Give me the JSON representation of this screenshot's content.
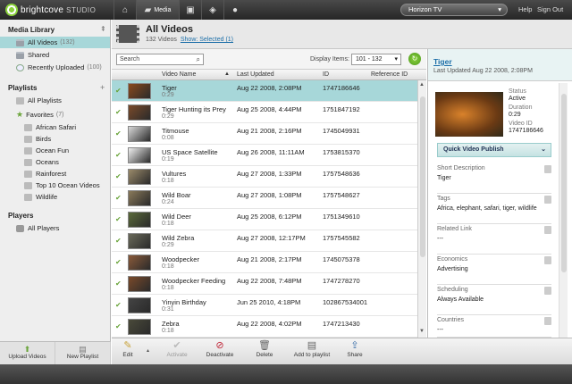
{
  "top": {
    "brand": "brightcove",
    "studio": "STUDIO",
    "nav_media_label": "Media",
    "account": "Horizon TV",
    "help": "Help",
    "signout": "Sign Out"
  },
  "sidebar": {
    "library_title": "Media Library",
    "library_items": [
      {
        "label": "All Videos",
        "count": "(132)"
      },
      {
        "label": "Shared",
        "count": ""
      },
      {
        "label": "Recently Uploaded",
        "count": "(100)"
      }
    ],
    "playlists_title": "Playlists",
    "all_playlists": "All Playlists",
    "favorites": {
      "label": "Favorites",
      "count": "(7)"
    },
    "playlist_items": [
      "African Safari",
      "Birds",
      "Ocean Fun",
      "Oceans",
      "Rainforest",
      "Top 10 Ocean Videos",
      "Wildlife"
    ],
    "players_title": "Players",
    "all_players": "All Players",
    "upload_label": "Upload Videos",
    "new_playlist_label": "New Playlist"
  },
  "header": {
    "title": "All Videos",
    "count": "132 Videos",
    "show_selected": "Show: Selected (1)"
  },
  "toolbar": {
    "search_placeholder": "Search",
    "display_label": "Display Items:",
    "display_value": "101 - 132"
  },
  "table": {
    "columns": [
      "Video Name",
      "Last Updated",
      "ID",
      "Reference ID"
    ],
    "rows": [
      {
        "name": "Tiger",
        "duration": "0:29",
        "updated": "Aug 22 2008, 2:08PM",
        "id": "1747186646",
        "selected": true
      },
      {
        "name": "Tiger Hunting its Prey",
        "duration": "0:29",
        "updated": "Aug 25 2008, 4:44PM",
        "id": "1751847192",
        "selected": false
      },
      {
        "name": "Titmouse",
        "duration": "0:08",
        "updated": "Aug 21 2008, 2:16PM",
        "id": "1745049931",
        "selected": false
      },
      {
        "name": "US Space Satellite",
        "duration": "0:19",
        "updated": "Aug 26 2008, 11:11AM",
        "id": "1753815370",
        "selected": false
      },
      {
        "name": "Vultures",
        "duration": "0:18",
        "updated": "Aug 27 2008, 1:33PM",
        "id": "1757548636",
        "selected": false
      },
      {
        "name": "Wild Boar",
        "duration": "0:24",
        "updated": "Aug 27 2008, 1:08PM",
        "id": "1757548627",
        "selected": false
      },
      {
        "name": "Wild Deer",
        "duration": "0:18",
        "updated": "Aug 25 2008, 6:12PM",
        "id": "1751349610",
        "selected": false
      },
      {
        "name": "Wild Zebra",
        "duration": "0:29",
        "updated": "Aug 27 2008, 12:17PM",
        "id": "1757545582",
        "selected": false
      },
      {
        "name": "Woodpecker",
        "duration": "0:18",
        "updated": "Aug 21 2008, 2:17PM",
        "id": "1745075378",
        "selected": false
      },
      {
        "name": "Woodpecker Feeding",
        "duration": "0:18",
        "updated": "Aug 22 2008, 7:48PM",
        "id": "1747278270",
        "selected": false
      },
      {
        "name": "Yinyin Birthday",
        "duration": "0:31",
        "updated": "Jun 25 2010, 4:18PM",
        "id": "102867534001",
        "selected": false
      },
      {
        "name": "Zebra",
        "duration": "0:18",
        "updated": "Aug 22 2008, 4:02PM",
        "id": "1747213430",
        "selected": false
      }
    ]
  },
  "actions": {
    "edit": "Edit",
    "activate": "Activate",
    "deactivate": "Deactivate",
    "delete": "Delete",
    "add_to_playlist": "Add to playlist",
    "share": "Share"
  },
  "detail": {
    "title": "Tiger",
    "last_updated": "Last Updated Aug 22 2008, 2:08PM",
    "status_label": "Status",
    "status": "Active",
    "duration_label": "Duration",
    "duration": "0:29",
    "videoid_label": "Video ID",
    "videoid": "1747186646",
    "quick_publish": "Quick Video Publish",
    "sections": [
      {
        "label": "Short Description",
        "value": "Tiger"
      },
      {
        "label": "Tags",
        "value": "Africa, elephant, safari, tiger, wildlife"
      },
      {
        "label": "Related Link",
        "value": "---"
      },
      {
        "label": "Economics",
        "value": "Advertising"
      },
      {
        "label": "Scheduling",
        "value": "Always Available"
      },
      {
        "label": "Countries",
        "value": "---"
      }
    ]
  },
  "colors": {
    "accent": "#8bd23c",
    "selection": "#a7d7d9",
    "link": "#1b6ea8"
  }
}
